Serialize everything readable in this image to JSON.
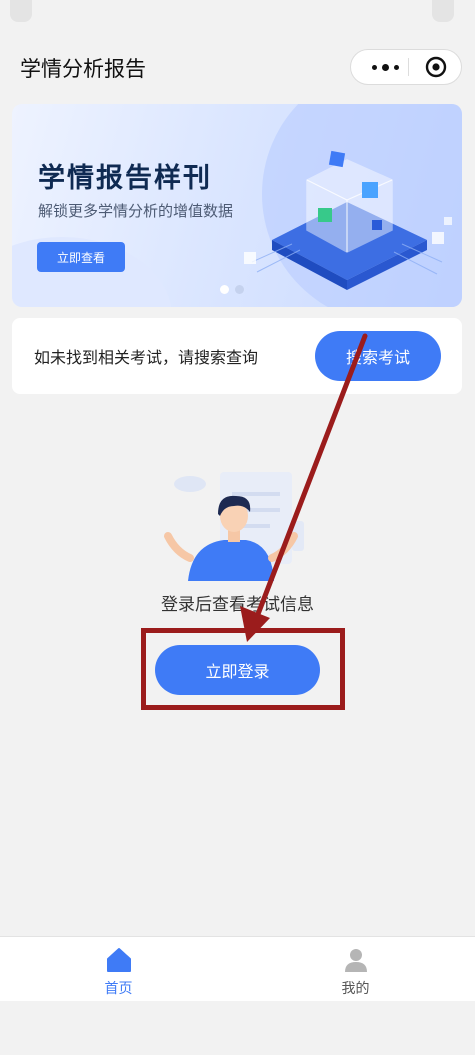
{
  "nav": {
    "title": "学情分析报告"
  },
  "banner": {
    "title": "学情报告样刊",
    "subtitle": "解锁更多学情分析的增值数据",
    "button": "立即查看"
  },
  "search": {
    "prompt": "如未找到相关考试，请搜索查询",
    "button": "搜索考试"
  },
  "login": {
    "hint": "登录后查看考试信息",
    "button": "立即登录"
  },
  "tabbar": {
    "items": [
      {
        "label": "首页",
        "icon": "home-icon",
        "active": true
      },
      {
        "label": "我的",
        "icon": "person-icon",
        "active": false
      }
    ]
  },
  "colors": {
    "accent": "#3f7bf6",
    "annotation": "#9b1c1c",
    "background": "#f2f2f2"
  }
}
